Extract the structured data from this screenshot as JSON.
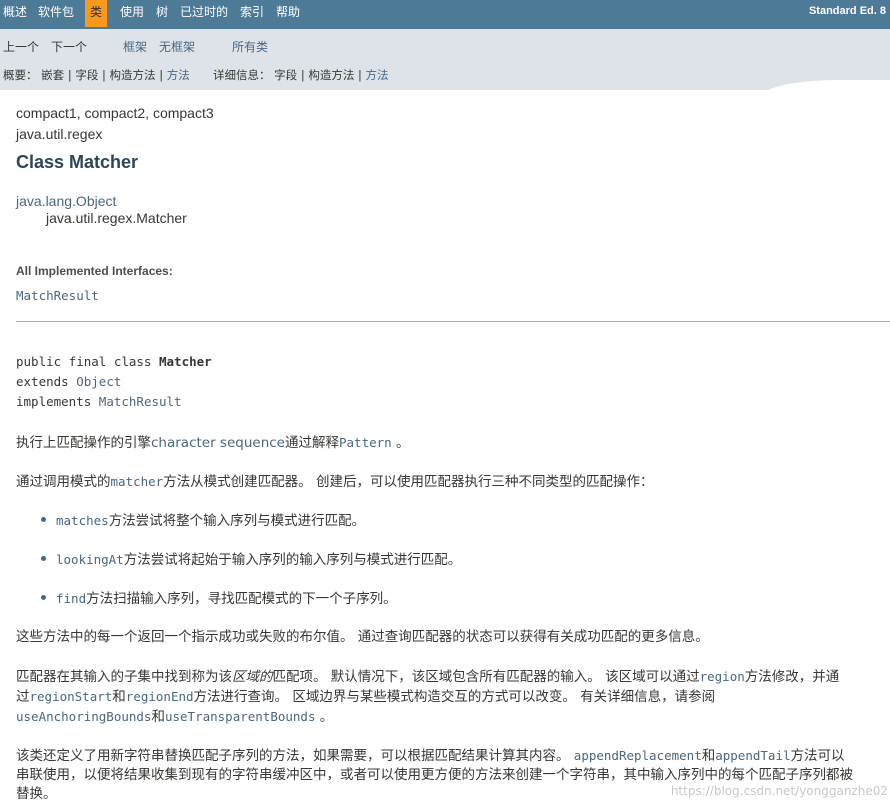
{
  "topnav": {
    "items": [
      "概述",
      "软件包",
      "类",
      "使用",
      "树",
      "已过时的",
      "索引",
      "帮助"
    ],
    "active_index": 2,
    "edition": "Standard Ed. 8"
  },
  "subnav": {
    "prev": "上一个",
    "next": "下一个",
    "frames": "框架",
    "no_frames": "无框架",
    "all_classes": "所有类",
    "summary_label": "概要：",
    "summary_nested": "嵌套",
    "summary_field": "字段",
    "summary_constr": "构造方法",
    "summary_method": "方法",
    "sep": "|",
    "detail_label": "详细信息：",
    "detail_field": "字段",
    "detail_constr": "构造方法",
    "detail_method": "方法"
  },
  "header": {
    "profiles": "compact1, compact2, compact3",
    "package": "java.util.regex",
    "title": "Class Matcher"
  },
  "inheritance": {
    "parent": "java.lang.Object",
    "child": "java.util.regex.Matcher"
  },
  "interfaces": {
    "label": "All Implemented Interfaces:",
    "value": "MatchResult"
  },
  "declaration": {
    "line1_kw": "public final class ",
    "line1_name": "Matcher",
    "line2_kw": "extends ",
    "line2_link": "Object",
    "line3_kw": "implements ",
    "line3_link": "MatchResult"
  },
  "desc": {
    "p1_a": "执行上匹配操作的引擎",
    "p1_link": "character sequence",
    "p1_b": "通过解释",
    "p1_code": "Pattern",
    "p1_c": " 。",
    "p2_a": "通过调用模式的",
    "p2_code": "matcher",
    "p2_b": "方法从模式创建匹配器。 创建后，可以使用匹配器执行三种不同类型的匹配操作：",
    "b1_code": "matches",
    "b1_text": "方法尝试将整个输入序列与模式进行匹配。",
    "b2_code": "lookingAt",
    "b2_text": "方法尝试将起始于输入序列的输入序列与模式进行匹配。",
    "b3_code": "find",
    "b3_text": "方法扫描输入序列，寻找匹配模式的下一个子序列。",
    "p3": "这些方法中的每一个返回一个指示成功或失败的布尔值。 通过查询匹配器的状态可以获得有关成功匹配的更多信息。",
    "p4_l1_a": "匹配器在其输入的子集中找到称为该",
    "p4_l1_em": "区域的",
    "p4_l1_b": "匹配项。 默认情况下，该区域包含所有匹配器的输入。 该区域可以通过",
    "p4_l1_code": "region",
    "p4_l1_c": "方法修改，并通",
    "p4_l2_a": "过",
    "p4_l2_code1": "regionStart",
    "p4_l2_b": "和",
    "p4_l2_code2": "regionEnd",
    "p4_l2_c": "方法进行查询。 区域边界与某些模式构造交互的方式可以改变。 有关详细信息，请参阅",
    "p4_l3_code1": "useAnchoringBounds",
    "p4_l3_b": "和",
    "p4_l3_code2": "useTransparentBounds",
    "p4_l3_c": " 。",
    "p5_l1_a": "该类还定义了用新字符串替换匹配子序列的方法，如果需要，可以根据匹配结果计算其内容。 ",
    "p5_l1_code1": "appendReplacement",
    "p5_l1_b": "和",
    "p5_l1_code2": "appendTail",
    "p5_l1_c": "方法可以",
    "p5_l2": "串联使用，以便将结果收集到现有的字符串缓冲区中，或者可以使用更方便的方法来创建一个字符串，其中输入序列中的每个匹配子序列都被",
    "p5_l3": "替换。"
  },
  "watermark": "https://blog.csdn.net/yongganzhe02",
  "colors": {
    "topnav": "#4d7a97",
    "active": "#f8981d",
    "subnav": "#dee3e9",
    "link": "#4a6782",
    "title": "#2c4557"
  }
}
